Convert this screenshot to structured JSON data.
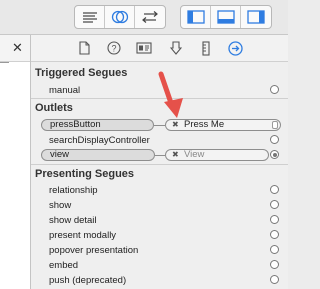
{
  "colors": {
    "accent": "#2f7de1",
    "arrow": "#e5514a"
  },
  "toolbar": {
    "editor_buttons": [
      "standard-editor-icon",
      "assistant-editor-icon",
      "version-editor-icon"
    ],
    "view_buttons": [
      "navigator-toggle-icon",
      "debug-area-toggle-icon",
      "utilities-toggle-icon"
    ]
  },
  "left_pane": {
    "close_glyph": "✕"
  },
  "inspector_tabs": [
    "file-icon",
    "help-icon",
    "identity-icon",
    "attributes-icon",
    "size-icon",
    "connections-icon"
  ],
  "triggered_segues": {
    "title": "Triggered Segues",
    "items": [
      {
        "label": "manual"
      }
    ]
  },
  "outlets": {
    "title": "Outlets",
    "items": [
      {
        "label": "pressButton",
        "target": "Press Me"
      },
      {
        "label": "searchDisplayController"
      },
      {
        "label": "view",
        "target": "View"
      }
    ]
  },
  "presenting_segues": {
    "title": "Presenting Segues",
    "items": [
      {
        "label": "relationship"
      },
      {
        "label": "show"
      },
      {
        "label": "show detail"
      },
      {
        "label": "present modally"
      },
      {
        "label": "popover presentation"
      },
      {
        "label": "embed"
      },
      {
        "label": "push (deprecated)"
      }
    ]
  }
}
